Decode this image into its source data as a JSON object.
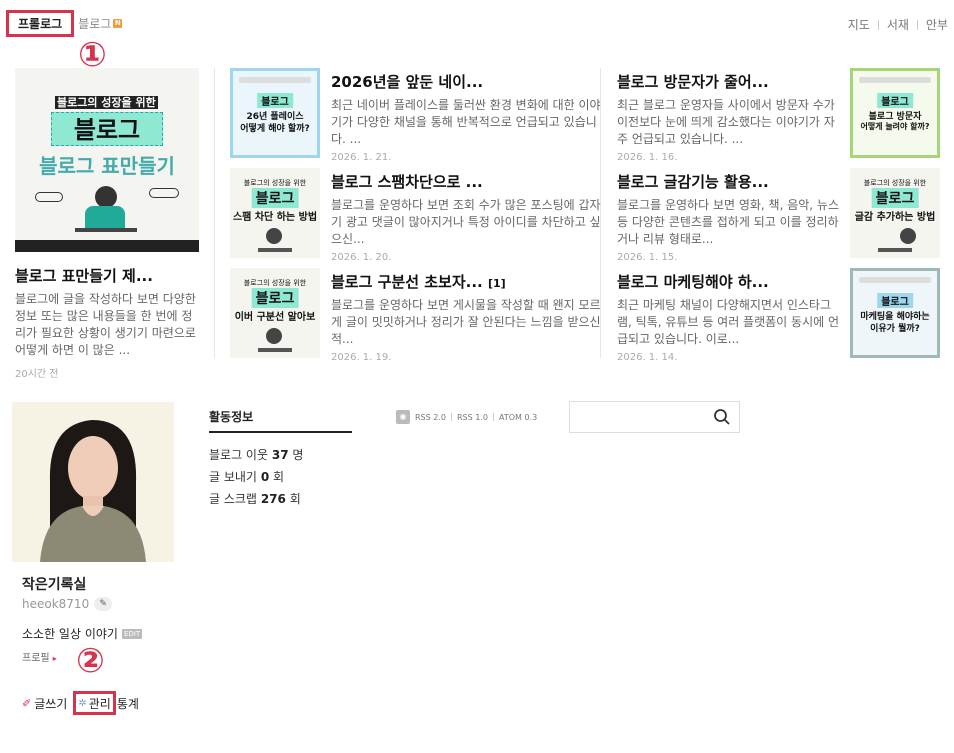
{
  "top_tabs": {
    "prologue": "프롤로그",
    "blog": "블로그",
    "blog_new": "N"
  },
  "top_right": [
    "지도",
    "서재",
    "안부"
  ],
  "callouts": {
    "one": "①",
    "two": "②"
  },
  "feature_post": {
    "title": "블로그 표만들기 제...",
    "excerpt": "블로그에 글을 작성하다 보면 다양한 정보 또는 많은 내용들을 한 번에 정리가 필요한 상황이 생기기 마련으로 어떻게 하면 이 많은 ...",
    "date": "20시간 전",
    "thumb_line1": "블로그의 성장을 위한",
    "thumb_line2": "블로그",
    "thumb_line3": "블로그 표만들기"
  },
  "posts_middle": [
    {
      "title": "2026년을 앞둔 네이...",
      "excerpt": "최근 네이버 플레이스를 둘러싼 환경 변화에 대한 이야기가 다양한 채널을 통해 반복적으로 언급되고 있습니다. ...",
      "date": "2026. 1. 21.",
      "thumb_a": "블로그",
      "thumb_b": "26년 플레이스",
      "thumb_c": "어떻게 해야 할까?"
    },
    {
      "title": "블로그 스팸차단으로 ...",
      "excerpt": "블로그를 운영하다 보면 조회 수가 많은 포스팅에 갑자기 광고 댓글이 많아지거나 특정 아이디를 차단하고 싶으신...",
      "date": "2026. 1. 20.",
      "thumb_a": "블로그의 성장을 위한",
      "thumb_b": "블로그",
      "thumb_c": "스팸 차단 하는 방법"
    },
    {
      "title": "블로그 구분선 초보자...",
      "count": "[1]",
      "excerpt": "블로그를 운영하다 보면 게시물을 작성할 때 왠지 모르게 글이 밋밋하거나 정리가 잘 안된다는 느낌을 받으신 적...",
      "date": "2026. 1. 19.",
      "thumb_a": "블로그의 성장을 위한",
      "thumb_b": "블로그",
      "thumb_c": "이버 구분선 알아보"
    }
  ],
  "posts_right": [
    {
      "title": "블로그 방문자가 줄어...",
      "excerpt": "최근 블로그 운영자들 사이에서 방문자 수가 이전보다 눈에 띄게 감소했다는 이야기가 자주 언급되고 있습니다. ...",
      "date": "2026. 1. 16.",
      "thumb_a": "블로그",
      "thumb_b": "블로그 방문자",
      "thumb_c": "어떻게 늘려야 할까?"
    },
    {
      "title": "블로그 글감기능 활용...",
      "excerpt": "블로그를 운영하다 보면 영화, 책, 음악, 뉴스 등 다양한 콘텐츠를 접하게 되고 이를 정리하거나 리뷰 형태로...",
      "date": "2026. 1. 15.",
      "thumb_a": "블로그의 성장을 위한",
      "thumb_b": "블로그",
      "thumb_c": "글감 추가하는 방법"
    },
    {
      "title": "블로그 마케팅해야 하...",
      "excerpt": "최근 마케팅 채널이 다양해지면서 인스타그램, 틱톡, 유튜브 등 여러 플랫폼이 동시에 언급되고 있습니다. 이로...",
      "date": "2026. 1. 14.",
      "thumb_a": "블로그",
      "thumb_b": "마케팅을 해야하는",
      "thumb_c": "이유가 뭘까?"
    }
  ],
  "profile": {
    "name": "작은기록실",
    "id": "heeok8710",
    "desc": "소소한 일상 이야기",
    "edit": "EDIT",
    "link": "프로필",
    "write": "글쓰기",
    "admin": "관리",
    "stats": "통계"
  },
  "activity": {
    "title": "활동정보",
    "rows": [
      {
        "label": "블로그 이웃",
        "value": "37",
        "unit": "명"
      },
      {
        "label": "글 보내기",
        "value": "0",
        "unit": "회"
      },
      {
        "label": "글 스크랩",
        "value": "276",
        "unit": "회"
      }
    ]
  },
  "rss": [
    "RSS 2.0",
    "RSS 1.0",
    "ATOM 0.3"
  ],
  "search": {
    "placeholder": ""
  }
}
